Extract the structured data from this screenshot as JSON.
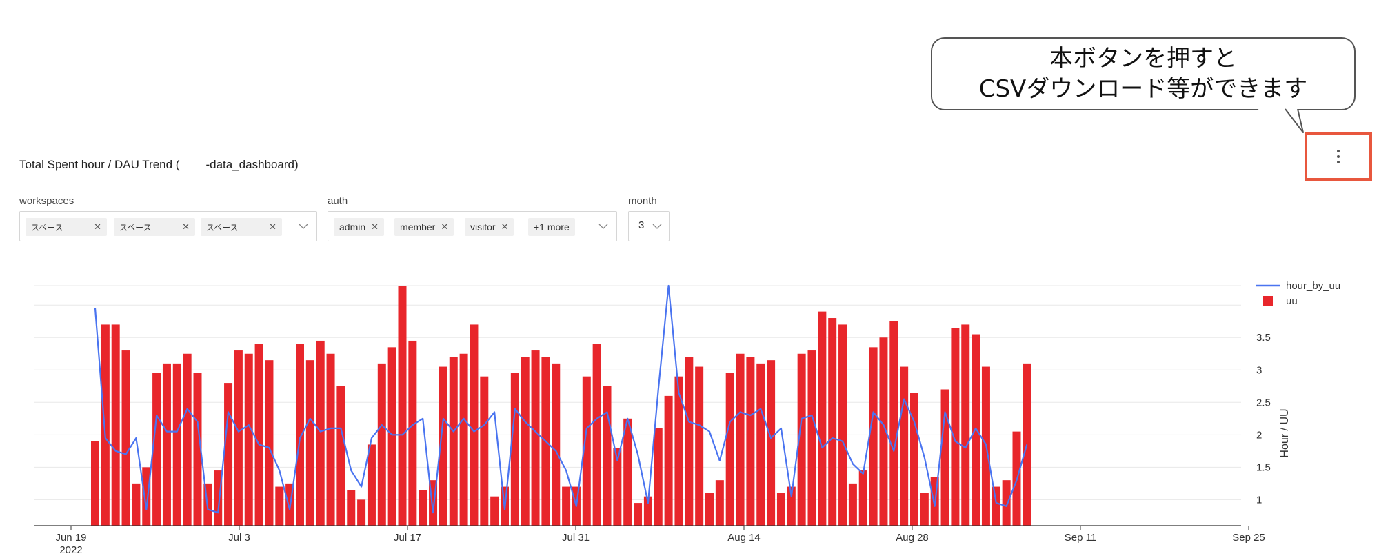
{
  "callout": {
    "line1": "本ボタンを押すと",
    "line2": "CSVダウンロード等ができます"
  },
  "menu_button": {
    "icon": "more-vertical-icon"
  },
  "panel": {
    "title_prefix": "Total Spent hour / DAU Trend (",
    "title_suffix": "-data_dashboard)"
  },
  "filters": {
    "workspaces": {
      "label": "workspaces",
      "tags": [
        "スペース",
        "スペース",
        "スペース"
      ]
    },
    "auth": {
      "label": "auth",
      "tags": [
        "admin",
        "member",
        "visitor"
      ],
      "more": "+1 more"
    },
    "month": {
      "label": "month",
      "value": "3"
    }
  },
  "chart_data": {
    "type": "bar",
    "secondary_type": "line",
    "y_label": "Hour / UU",
    "y_ticks": [
      "1",
      "1.5",
      "2",
      "2.5",
      "3",
      "3.5"
    ],
    "ylim": [
      0.6,
      4.3
    ],
    "x_ticks": [
      "Jun 19",
      "Jul 3",
      "Jul 17",
      "Jul 31",
      "Aug 14",
      "Aug 28",
      "Sep 11",
      "Sep 25"
    ],
    "x_tick_sub": "2022",
    "legend": [
      {
        "name": "hour_by_uu",
        "kind": "line",
        "color": "#4a74f0"
      },
      {
        "name": "uu",
        "kind": "bar",
        "color": "#e8262b"
      }
    ],
    "bar_color": "#e8262b",
    "line_color": "#4a74f0",
    "uu": [
      1.9,
      3.7,
      3.7,
      3.3,
      1.25,
      1.5,
      2.95,
      3.1,
      3.1,
      3.25,
      2.95,
      1.25,
      1.45,
      2.8,
      3.3,
      3.25,
      3.4,
      3.15,
      1.2,
      1.25,
      3.4,
      3.15,
      3.45,
      3.25,
      2.75,
      1.15,
      1.0,
      1.85,
      3.1,
      3.35,
      4.3,
      3.45,
      1.15,
      1.3,
      3.05,
      3.2,
      3.25,
      3.7,
      2.9,
      1.05,
      1.2,
      2.95,
      3.2,
      3.3,
      3.2,
      3.1,
      1.2,
      1.2,
      2.9,
      3.4,
      2.75,
      1.8,
      2.25,
      0.95,
      1.05,
      2.1,
      2.6,
      2.9,
      3.2,
      3.05,
      1.1,
      1.3,
      2.95,
      3.25,
      3.2,
      3.1,
      3.15,
      1.1,
      1.2,
      3.25,
      3.3,
      3.9,
      3.8,
      3.7,
      1.25,
      1.45,
      3.35,
      3.5,
      3.75,
      3.05,
      2.65,
      1.1,
      1.35,
      2.7,
      3.65,
      3.7,
      3.55,
      3.05,
      1.2,
      1.3,
      2.05,
      3.1
    ],
    "hour_by_uu": [
      3.95,
      1.95,
      1.75,
      1.7,
      1.95,
      0.85,
      2.3,
      2.05,
      2.05,
      2.4,
      2.2,
      0.85,
      0.8,
      2.35,
      2.05,
      2.15,
      1.85,
      1.8,
      1.45,
      0.85,
      1.95,
      2.25,
      2.05,
      2.1,
      2.1,
      1.45,
      1.2,
      1.95,
      2.15,
      2.0,
      2.0,
      2.15,
      2.25,
      0.8,
      2.25,
      2.05,
      2.25,
      2.05,
      2.15,
      2.35,
      0.85,
      2.4,
      2.2,
      2.05,
      1.9,
      1.75,
      1.45,
      0.9,
      2.1,
      2.25,
      2.35,
      1.6,
      2.25,
      1.7,
      0.95,
      2.7,
      4.3,
      2.65,
      2.2,
      2.15,
      2.05,
      1.6,
      2.2,
      2.35,
      2.3,
      2.4,
      1.95,
      2.1,
      1.05,
      2.25,
      2.3,
      1.8,
      1.95,
      1.9,
      1.55,
      1.4,
      2.35,
      2.15,
      1.75,
      2.55,
      2.2,
      1.65,
      0.9,
      2.35,
      1.9,
      1.8,
      2.1,
      1.85,
      0.95,
      0.9,
      1.3,
      1.85
    ]
  }
}
